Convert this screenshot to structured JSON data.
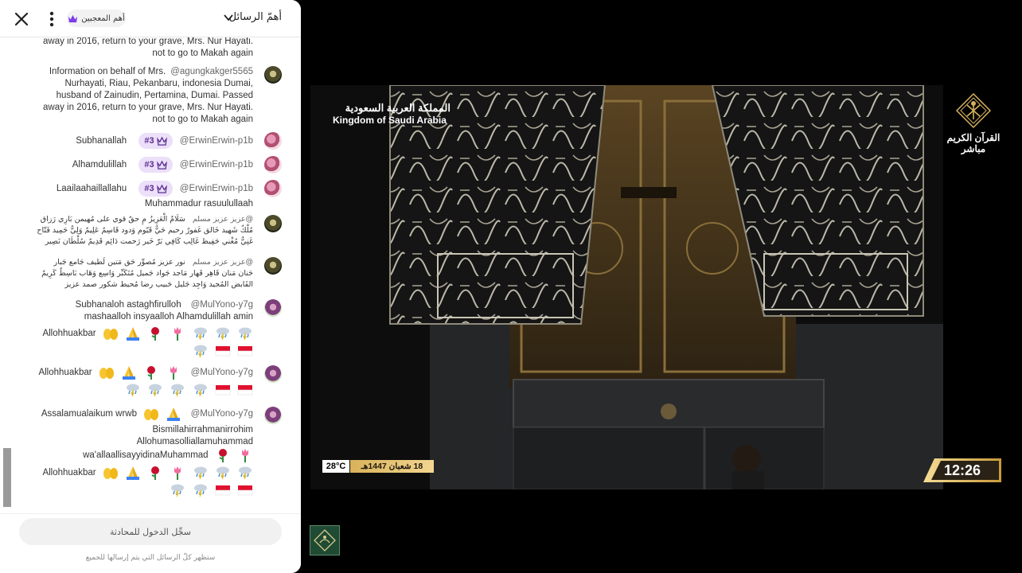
{
  "chat": {
    "header": {
      "title": "أهمّ الرسائل",
      "top_fans_label": "أهم المعجبين"
    },
    "messages": [
      {
        "text_lines": [
          "away in 2016, return to your grave, Mrs. Nur Hayati.",
          "not to go to Makah again"
        ]
      },
      {
        "author": "@agungkakger5565",
        "text_lines": [
          "Information on behalf of Mrs.",
          "Nurhayati, Riau, Pekanbaru, indonesia Dumai,",
          "husband of Zainudin, Pertamina, Dumai. Passed",
          "away in 2016, return to your grave, Mrs. Nur Hayati.",
          "not to go to Makah again"
        ]
      },
      {
        "author": "@ErwinErwin-p1b",
        "rank": "#3",
        "text": "Subhanallah"
      },
      {
        "author": "@ErwinErwin-p1b",
        "rank": "#3",
        "text": "Alhamdulillah"
      },
      {
        "author": "@ErwinErwin-p1b",
        "rank": "#3",
        "text": "Laailaahaillallahu",
        "text2": "Muhammadur rasuulullaah"
      },
      {
        "author": "@عزيز عزيز مسلم",
        "text_lines": [
          "سَلَامٌ الْعَزِيزُ مِ حقٌ قوي على مُهيمن بَارِي رَزاق",
          "مُلْكٌ شَهيد خَالق غَفورٌ رحيم حَيٌّ قَيّوم وَدود قَاسِمٌ عَلِيمٌ وَلِيٌّ حَمِيد فَتّاح",
          "غَنِيٌّ مُغْني حَفِيظ غَالِب كَافِي بَرّ خَير رَحمت دَائِم قَدِيمٌ سُلْطَان نَصِير"
        ]
      },
      {
        "author": "@عزيز عزيز مسلم",
        "text_lines": [
          "نور عزيز مُصوِّر حَق مَتين لَطيف جَامع جَبار",
          "حَنان مَنان قَاهِر قَهار مَاجد جَواد جَميل مُتَكَبِّر وَاسِع وَهَاب بَاسِطٌ كَرِيمٌ",
          "القَابض المُجيد وَاجِد جَليل حَبيب رضا مُحيط شكور صمد عزيز"
        ]
      },
      {
        "author": "@MulYono-y7g",
        "text_lines": [
          "Subhanaloh astaghfirulloh",
          "mashaalloh insyaalloh Alhamdulillah amin",
          "Allohhuakbar"
        ]
      },
      {
        "author": "@MulYono-y7g",
        "text": "Allohhuakbar"
      },
      {
        "author": "@MulYono-y7g",
        "text_lines": [
          "Assalamualaikum wrwb",
          "Bismillahirrahmanirrohim",
          "Allohumasolliallamuhammad",
          "wa'allaallisayyidinaMuhammad",
          "Allohhuakbar"
        ]
      }
    ],
    "footer": {
      "login_label": "سجِّل الدخول للمحادثة",
      "note": "ستظهر كلّ الرسائل التي يتم إرسالها للجميع"
    }
  },
  "video": {
    "logo_ar": "المملكة العربية السعودية",
    "logo_en": "Kingdom of Saudi Arabia",
    "channel_name": "القرآن الكريم",
    "live_label": "مباشر",
    "temperature": "28°C",
    "hijri_date": "18 شعبان 1447هـ",
    "time": "12:26"
  },
  "colors": {
    "rank_badge_bg": "#ecdff9",
    "rank_badge_text": "#5b2d91",
    "gold_bar": "#e6c274"
  }
}
